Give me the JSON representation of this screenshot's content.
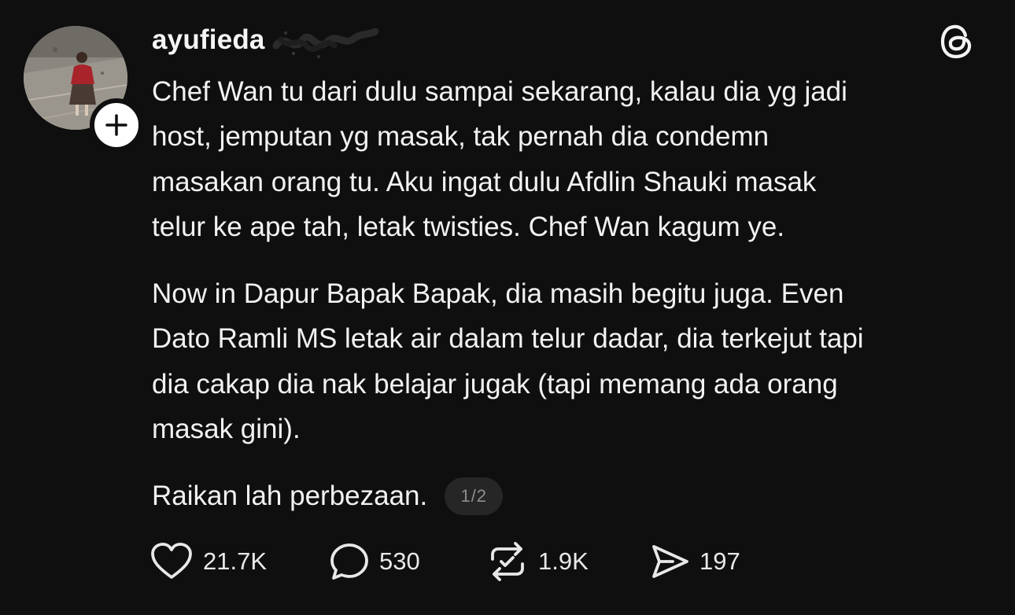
{
  "author": {
    "username": "ayufieda"
  },
  "post": {
    "paragraphs": [
      "Chef Wan tu dari dulu sampai sekarang, kalau dia yg jadi\nhost, jemputan yg masak, tak pernah dia condemn\nmasakan orang tu. Aku ingat dulu Afdlin Shauki masak\ntelur ke ape tah, letak twisties. Chef Wan kagum ye.",
      "Now in Dapur Bapak Bapak, dia masih begitu juga. Even\nDato Ramli MS letak air dalam telur dadar, dia terkejut tapi\ndia cakap dia nak belajar jugak (tapi memang ada orang\nmasak gini).",
      "Raikan lah perbezaan."
    ],
    "page_indicator": "1/2"
  },
  "actions": {
    "likes": "21.7K",
    "replies": "530",
    "reposts": "1.9K",
    "shares": "197"
  },
  "icons": {
    "brand": "threads-logo-icon",
    "like": "heart-icon",
    "reply": "speech-bubble-icon",
    "repost": "repost-icon",
    "share": "send-icon",
    "follow": "plus-icon"
  },
  "colors": {
    "background": "#0f0f0f",
    "text": "#f2f2f2",
    "muted": "#8d8d8d",
    "pill": "#262626"
  }
}
